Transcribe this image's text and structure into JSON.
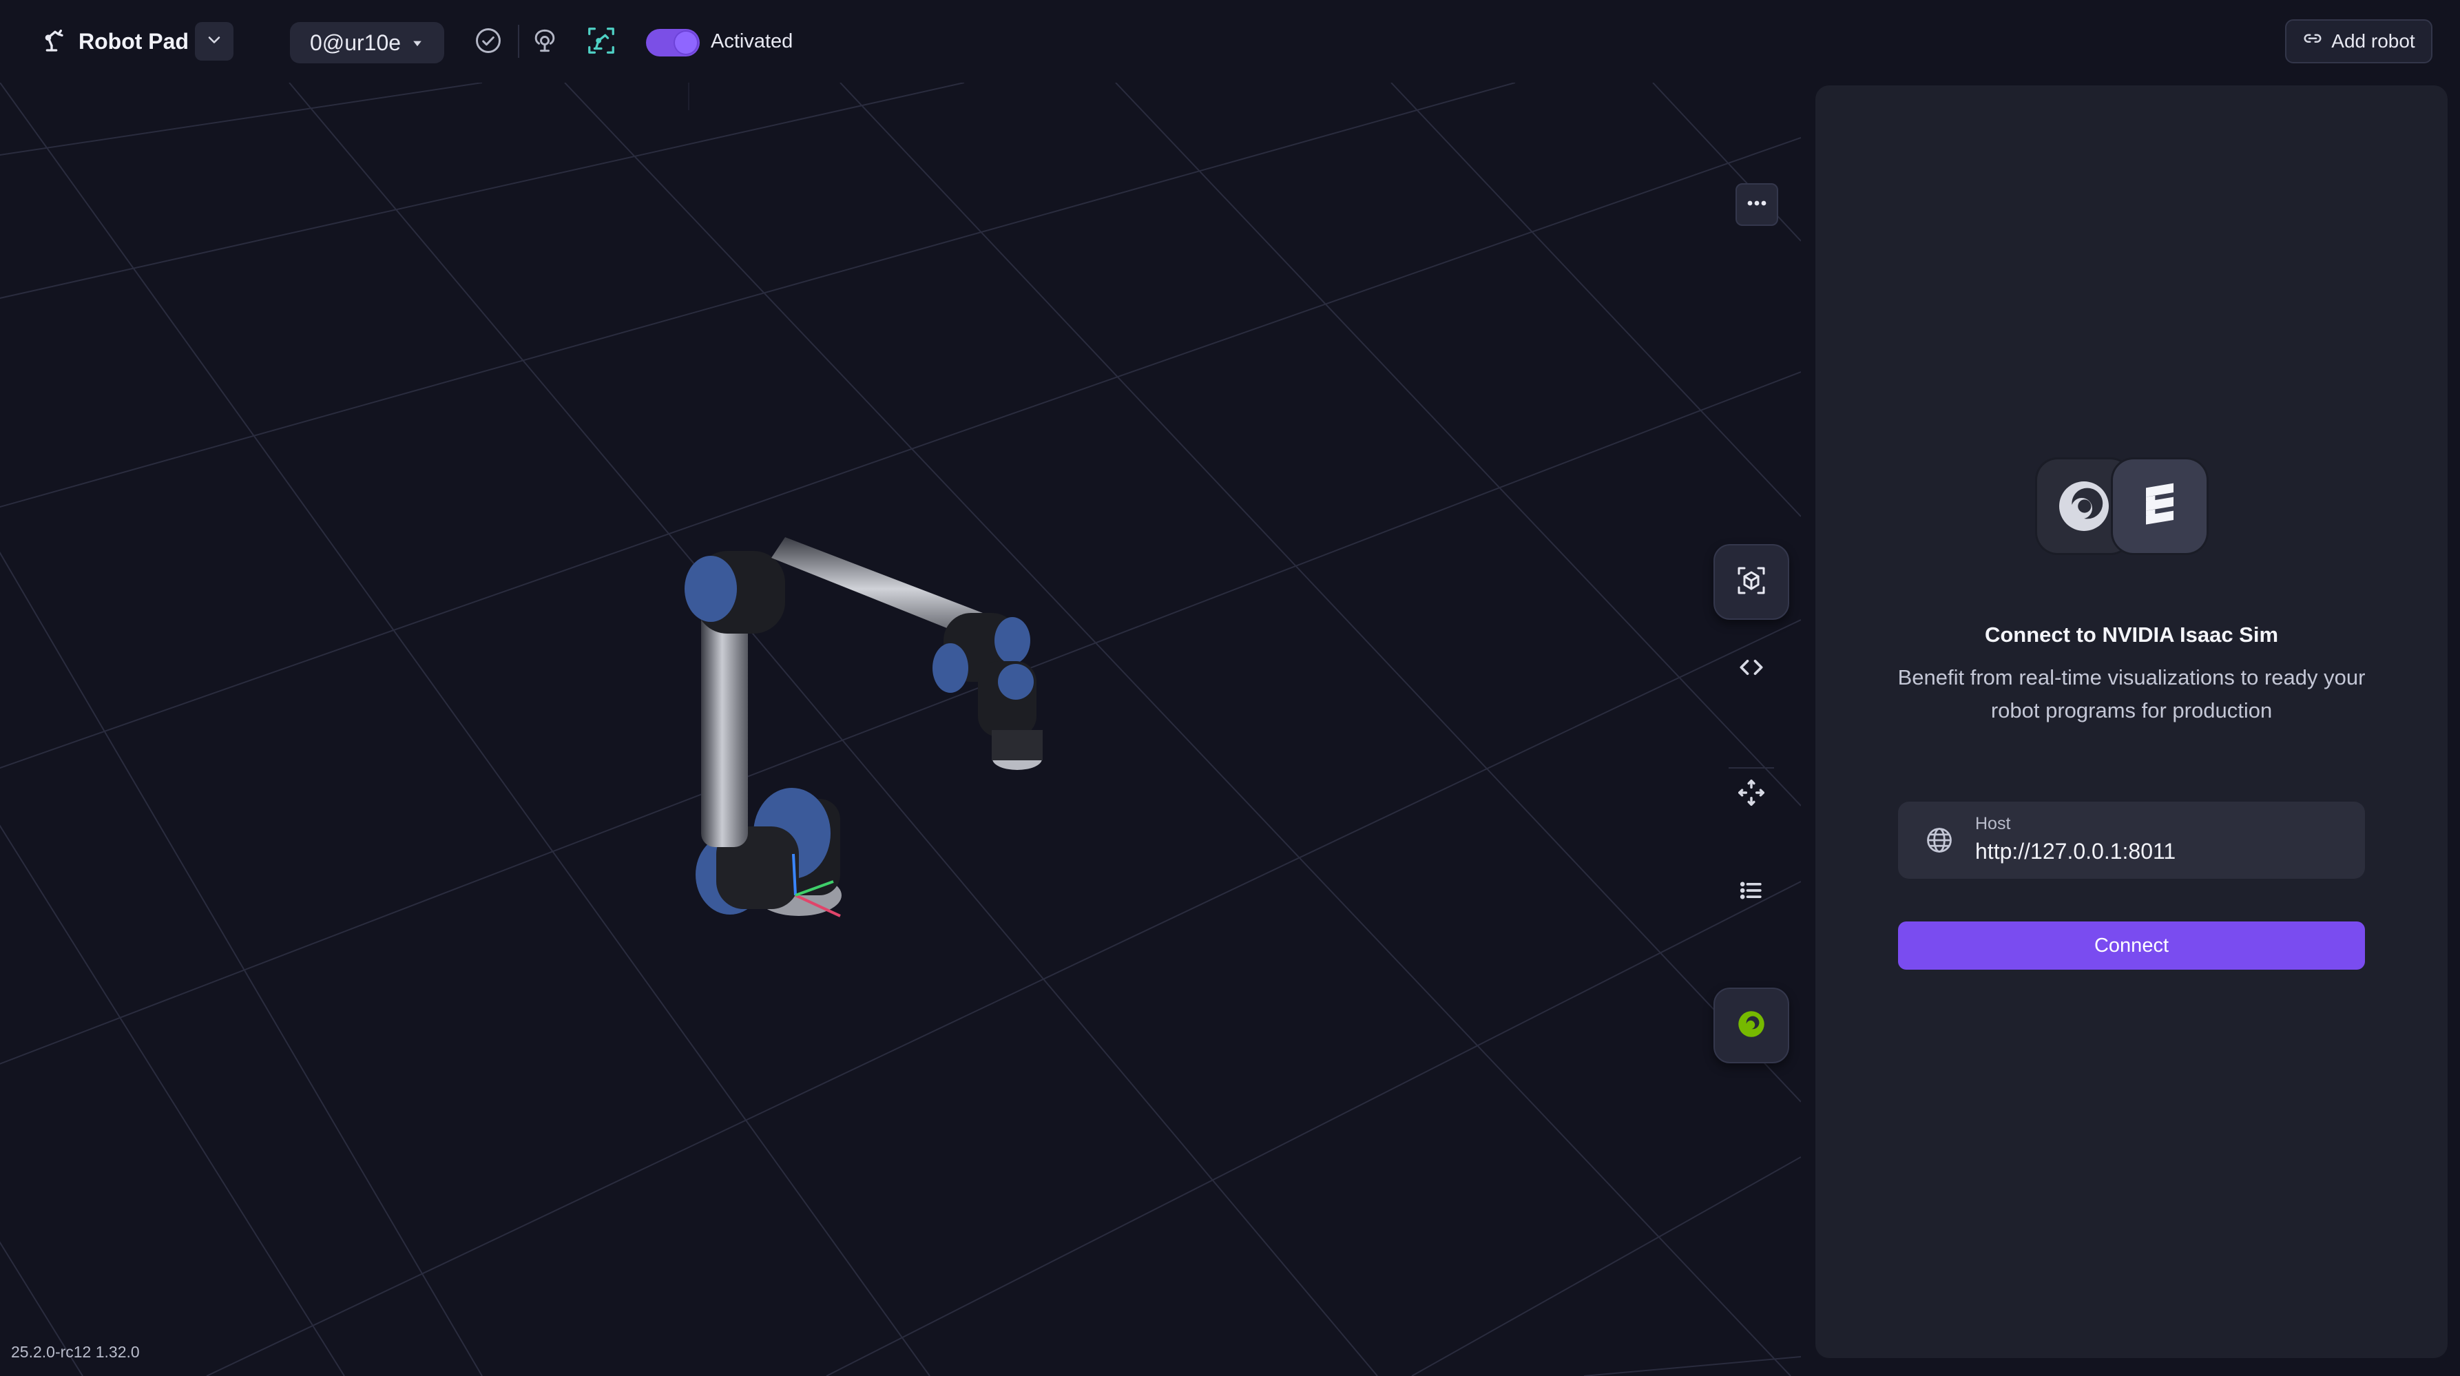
{
  "header": {
    "app_title": "Robot Pad",
    "robot_selector": "0@ur10e",
    "activation_status": "Activated",
    "add_robot_label": "Add robot"
  },
  "footer": {
    "version": "25.2.0-rc12 1.32.0"
  },
  "connect_panel": {
    "title": "Connect to NVIDIA Isaac Sim",
    "description": "Benefit from real-time visualizations to ready your robot programs for production",
    "host_label": "Host",
    "host_value": "http://127.0.0.1:8011",
    "connect_label": "Connect"
  },
  "icons": [
    "robot-pad-icon",
    "chevron-down-icon",
    "caret-down-icon",
    "check-circle-icon",
    "safety-icon",
    "robot-arm-icon",
    "link-icon",
    "more-icon",
    "view-cube-icon",
    "code-icon",
    "move-icon",
    "list-icon",
    "isaac-sim-icon",
    "isaac-logo-icon",
    "wandelbots-logo-icon",
    "globe-icon"
  ],
  "colors": {
    "background": "#12131f",
    "panel": "#1e202c",
    "accent": "#7a4cf0",
    "toggle": "#7b4fe6",
    "teal_icon": "#4fd1c5",
    "isaac_green": "#76b900"
  },
  "toggle_state": {
    "activated": true
  }
}
